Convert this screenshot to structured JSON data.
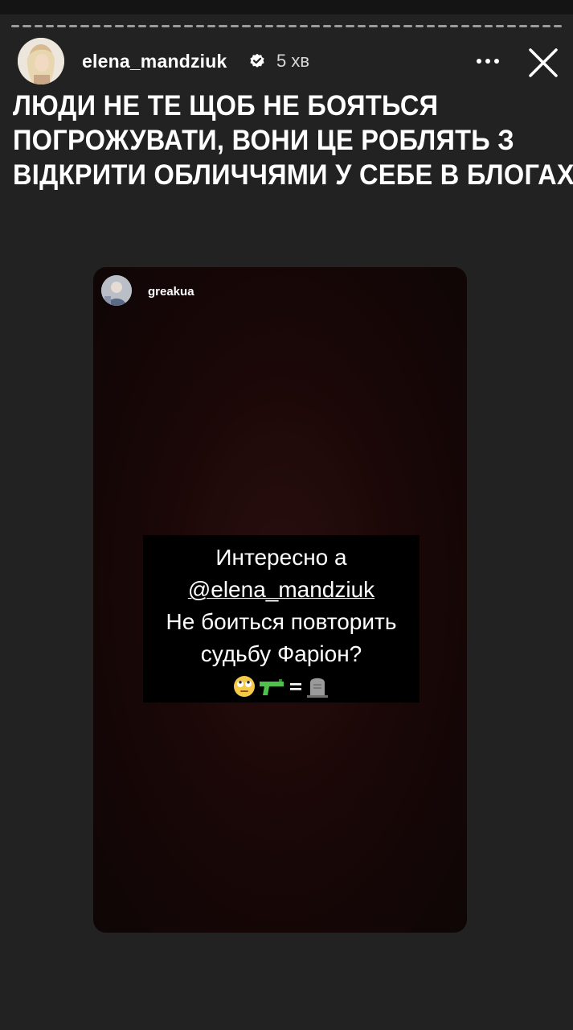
{
  "header": {
    "username": "elena_mandziuk",
    "verified_icon": "verified-badge-icon",
    "time": "5 хв",
    "more_icon": "more-horizontal-icon",
    "close_icon": "close-icon"
  },
  "story": {
    "headline_lines": [
      "ЛЮДИ НЕ ТЕ ЩОБ НЕ БОЯТЬСЯ",
      "ПОГРОЖУВАТИ, ВОНИ ЦЕ РОБЛЯТЬ З",
      "ВІДКРИТИ ОБЛИЧЧЯМИ У СЕБЕ В БЛОГАХ"
    ]
  },
  "shared_story": {
    "username": "greakua",
    "quote_line1": "Интересно а",
    "mention": "@elena_mandziuk",
    "quote_line3": "Не боиться повторить",
    "quote_line4": "судьбу Фаріон?",
    "emoji_icons": [
      "face-with-rolling-eyes-icon",
      "water-pistol-icon",
      "equals-icon",
      "headstone-icon"
    ],
    "emoji_text": "🙄🔫=🪦"
  },
  "colors": {
    "background": "#222222",
    "card_gradient_center": "#2a0f0f",
    "quote_box": "#000000"
  }
}
